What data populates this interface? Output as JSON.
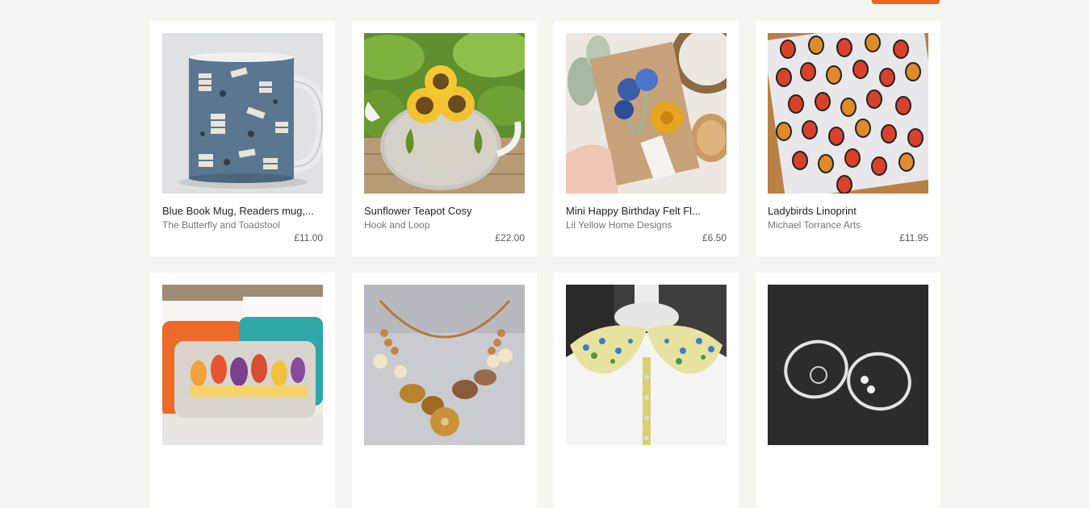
{
  "colors": {
    "page_background": "#f5f5f1",
    "card_background": "#ffffff",
    "accent": "#f1641e",
    "title_text": "#222222",
    "shop_text": "#757575",
    "price_text": "#595959"
  },
  "products": [
    {
      "title": "Blue Book Mug, Readers mug,...",
      "shop": "The Butterfly and Toadstool",
      "price": "£11.00",
      "image": "blue-book-mug"
    },
    {
      "title": "Sunflower Teapot Cosy",
      "shop": "Hook and Loop",
      "price": "£22.00",
      "image": "sunflower-teapot-cosy"
    },
    {
      "title": "Mini Happy Birthday Felt Fl...",
      "shop": "Lil Yellow Home Designs",
      "price": "£6.50",
      "image": "felt-flower-card"
    },
    {
      "title": "Ladybirds Linoprint",
      "shop": "Michael Torrance Arts",
      "price": "£11.95",
      "image": "ladybird-print"
    },
    {
      "image": "retro-tree-cushion"
    },
    {
      "image": "shell-flower-necklace"
    },
    {
      "image": "floral-peter-pan-collar"
    },
    {
      "image": "silver-hoop-earrings"
    }
  ]
}
